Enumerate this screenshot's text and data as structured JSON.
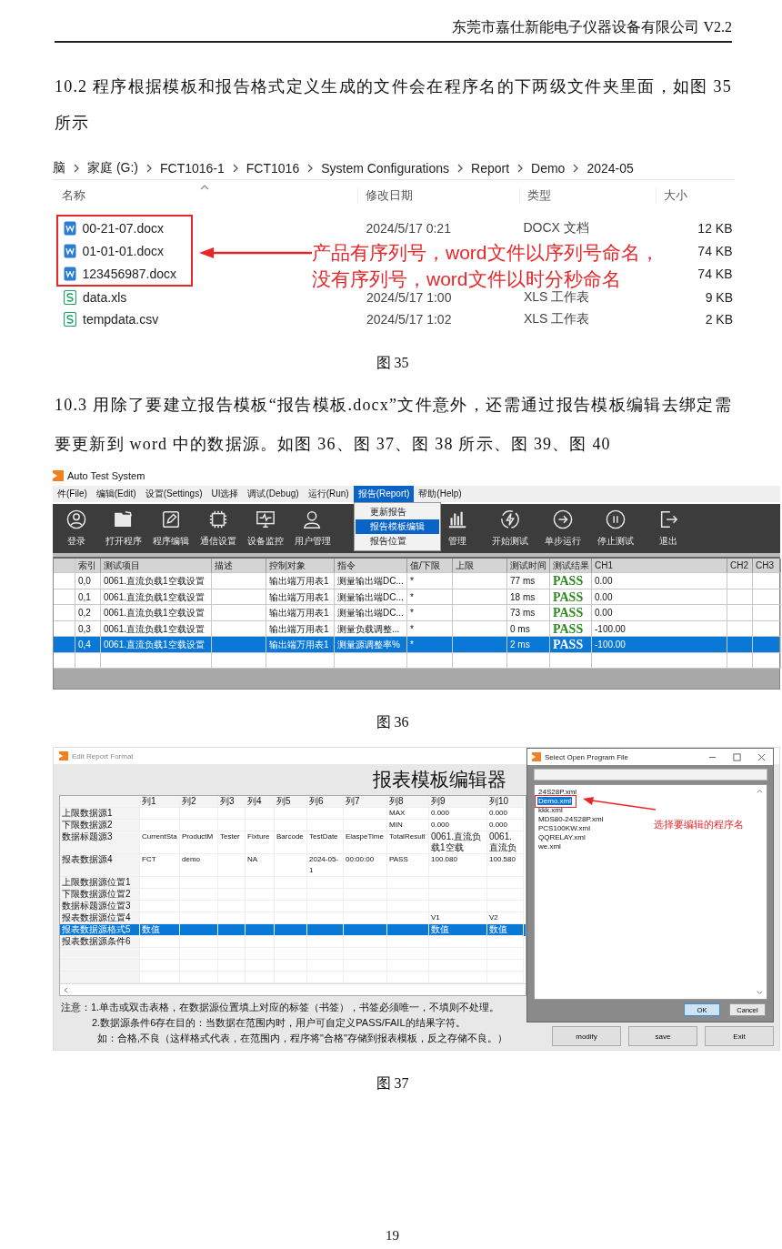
{
  "page_header": "东莞市嘉仕新能电子仪器设备有限公司 V2.2",
  "section_10_2": "10.2 程序根据模板和报告格式定义生成的文件会在程序名的下两级文件夹里面，如图 35 所示",
  "figure_35": {
    "address_bar": [
      "脑",
      "家庭 (G:)",
      "FCT1016-1",
      "FCT1016",
      "System Configurations",
      "Report",
      "Demo",
      "2024-05"
    ],
    "columns": [
      "名称",
      "修改日期",
      "类型",
      "大小"
    ],
    "files": [
      {
        "name": "00-21-07.docx",
        "kind": "docx",
        "date": "2024/5/17 0:21",
        "type": "DOCX 文档",
        "size": "12 KB",
        "marked": true
      },
      {
        "name": "01-01-01.docx",
        "kind": "docx",
        "size": "74 KB",
        "marked": true
      },
      {
        "name": "123456987.docx",
        "kind": "docx",
        "size": "74 KB",
        "marked": true
      },
      {
        "name": "data.xls",
        "kind": "sheet",
        "date": "2024/5/17 1:00",
        "type": "XLS 工作表",
        "size": "9 KB",
        "marked": false
      },
      {
        "name": "tempdata.csv",
        "kind": "sheet",
        "date": "2024/5/17 1:02",
        "type": "XLS 工作表",
        "size": "2 KB",
        "marked": false
      }
    ],
    "callout": [
      "产品有序列号，word文件以序列号命名，",
      "没有序列号，word文件以时分秒命名"
    ],
    "caption": "图 35"
  },
  "section_10_3": "10.3 用除了要建立报告模板“报告模板.docx”文件意外，还需通过报告模板编辑去绑定需要更新到 word 中的数据源。如图 36、图 37、图 38 所示、图 39、图 40",
  "figure_36": {
    "title": "Auto Test System",
    "menu": [
      {
        "label": "件(File)",
        "selected": false
      },
      {
        "label": "编辑(Edit)",
        "selected": false
      },
      {
        "label": "设置(Settings)",
        "selected": false
      },
      {
        "label": "UI选择",
        "selected": false
      },
      {
        "label": "调试(Debug)",
        "selected": false
      },
      {
        "label": "运行(Run)",
        "selected": false
      },
      {
        "label": "报告(Report)",
        "selected": true
      },
      {
        "label": "帮助(Help)",
        "selected": false
      }
    ],
    "dropdown": [
      {
        "label": "更新报告",
        "selected": false
      },
      {
        "label": "报告模板编辑",
        "selected": true
      },
      {
        "label": "报告位置",
        "selected": false
      }
    ],
    "toolbar": [
      {
        "label": "登录",
        "kind": "user"
      },
      {
        "label": "打开程序",
        "kind": "folder"
      },
      {
        "label": "程序编辑",
        "kind": "edit"
      },
      {
        "label": "通信设置",
        "kind": "chip"
      },
      {
        "label": "设备监控",
        "kind": "monitor"
      },
      {
        "label": "用户管理",
        "kind": "users"
      },
      {
        "label": "管理",
        "kind": "chart"
      },
      {
        "label": "开始测试",
        "kind": "bolt"
      },
      {
        "label": "单步运行",
        "kind": "arrow"
      },
      {
        "label": "停止测试",
        "kind": "pause"
      },
      {
        "label": "退出",
        "kind": "exit"
      }
    ],
    "columns": [
      "索引",
      "测试项目",
      "描述",
      "控制对象",
      "指令",
      "值/下限",
      "上限",
      "测试时间",
      "测试结果",
      "CH1",
      "CH2",
      "CH3"
    ],
    "rows": [
      {
        "index": "0,0",
        "item": "0061.直流负载1空载设置",
        "target": "输出端万用表1",
        "command": "测量输出端DC...",
        "lower": "*",
        "time": "77 ms",
        "result": "PASS",
        "ch1": "0.00",
        "selected": false
      },
      {
        "index": "0,1",
        "item": "0061.直流负载1空载设置",
        "target": "输出端万用表1",
        "command": "测量输出端DC...",
        "lower": "*",
        "time": "18 ms",
        "result": "PASS",
        "ch1": "0.00",
        "selected": false
      },
      {
        "index": "0,2",
        "item": "0061.直流负载1空载设置",
        "target": "输出端万用表1",
        "command": "测量输出端DC...",
        "lower": "*",
        "time": "73 ms",
        "result": "PASS",
        "ch1": "0.00",
        "selected": false
      },
      {
        "index": "0,3",
        "item": "0061.直流负载1空载设置",
        "target": "输出端万用表1",
        "command": "测量负载调整...",
        "lower": "*",
        "time": "0 ms",
        "result": "PASS",
        "ch1": "-100.00",
        "selected": false
      },
      {
        "index": "0,4",
        "item": "0061.直流负载1空载设置",
        "target": "输出端万用表1",
        "command": "测量源调整率%",
        "lower": "*",
        "time": "2 ms",
        "result": "PASS",
        "ch1": "-100.00",
        "selected": true
      }
    ],
    "caption": "图 36"
  },
  "figure_37": {
    "window_title": "Edit Report Format",
    "heading": "报表模板编辑器",
    "columns": [
      "列1",
      "列2",
      "列3",
      "列4",
      "列5",
      "列6",
      "列7",
      "列8",
      "列9",
      "列10"
    ],
    "rows": [
      {
        "label": "上限数据源1",
        "cells": {
          "8": "MAX",
          "9": "0.000",
          "10": "0.000"
        },
        "selected": false
      },
      {
        "label": "下限数据源2",
        "cells": {
          "8": "MIN",
          "9": "0.000",
          "10": "0.000"
        },
        "selected": false
      },
      {
        "label": "数据标题源3",
        "cells": {
          "1": "CurrentSta",
          "2": "ProductM",
          "3": "Tester",
          "4": "Fixture",
          "5": "Barcode",
          "6": "TestDate",
          "7": "ElaspeTime",
          "8": "TotalResult",
          "9": "0061.直流负载1空载",
          "10": "0061.直流负"
        },
        "selected": false
      },
      {
        "label": "报表数据源4",
        "cells": {
          "1": "FCT",
          "2": "demo",
          "4": "NA",
          "6": "2024-05-1",
          "7": "00:00:00",
          "8": "PASS",
          "9": "100.080",
          "10": "100.580"
        },
        "selected": false
      },
      {
        "label": "上限数据源位置1",
        "cells": {},
        "selected": false
      },
      {
        "label": "下限数据源位置2",
        "cells": {},
        "selected": false
      },
      {
        "label": "数据标题源位置3",
        "cells": {},
        "selected": false
      },
      {
        "label": "报表数据源位置4",
        "cells": {
          "9": "V1",
          "10": "V2"
        },
        "selected": false
      },
      {
        "label": "报表数据源格式5",
        "cells": {
          "1": "数值",
          "9": "数值",
          "10": "数值"
        },
        "selected": true
      },
      {
        "label": "报表数据源条件6",
        "cells": {},
        "selected": false
      }
    ],
    "notes": [
      "注意：1.单击或双击表格，在数据源位置填上对应的标签（书签），书签必须唯一，不填则不处理。",
      "2.数据源条件6存在目的：当数据在范围内时，用户可自定义PASS/FAIL的结果字符。",
      "如：合格,不良（这样格式代表，在范围内，程序将\"合格\"存储到报表模板，反之存储不良。）"
    ],
    "buttons": [
      "modify",
      "save",
      "Exit"
    ],
    "dialog": {
      "title": "Select Open Program File",
      "files": [
        {
          "name": "24S28P.xml",
          "selected": false
        },
        {
          "name": "Demo.xml",
          "selected": true
        },
        {
          "name": "kkk.xml",
          "selected": false
        },
        {
          "name": "MDS80-24S28P.xml",
          "selected": false
        },
        {
          "name": "PCS100KW.xml",
          "selected": false
        },
        {
          "name": "QQRELAY.xml",
          "selected": false
        },
        {
          "name": "we.xml",
          "selected": false
        }
      ],
      "callout": "选择要编辑的程序名",
      "buttons": [
        {
          "label": "OK",
          "default": true
        },
        {
          "label": "Cancel",
          "default": false
        }
      ]
    },
    "caption": "图 37"
  },
  "page_number": "19"
}
